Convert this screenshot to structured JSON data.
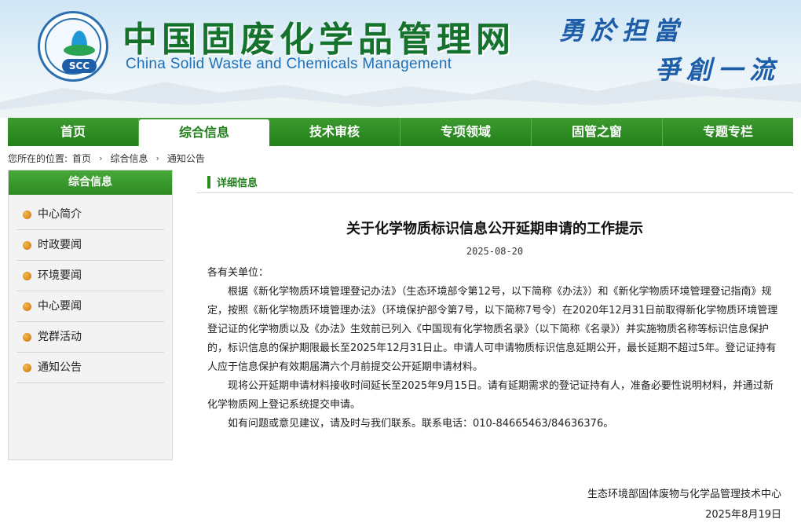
{
  "header": {
    "logo_text": "SCC",
    "title_cn": "中国固废化学品管理网",
    "title_en": "China Solid Waste and Chemicals Management",
    "slogan_line1": "勇於担當",
    "slogan_line2": "爭創一流"
  },
  "nav": {
    "items": [
      "首页",
      "综合信息",
      "技术审核",
      "专项领域",
      "固管之窗",
      "专题专栏"
    ],
    "active_index": 1
  },
  "breadcrumb": {
    "prefix": "您所在的位置:",
    "items": [
      "首页",
      "综合信息",
      "通知公告"
    ],
    "separator": "›"
  },
  "sidebar": {
    "title": "综合信息",
    "items": [
      "中心简介",
      "时政要闻",
      "环境要闻",
      "中心要闻",
      "党群活动",
      "通知公告"
    ]
  },
  "content": {
    "section_label": "详细信息",
    "title": "关于化学物质标识信息公开延期申请的工作提示",
    "date": "2025-08-20",
    "greeting": "各有关单位：",
    "paragraphs": [
      "根据《新化学物质环境管理登记办法》（生态环境部令第12号，以下简称《办法》）和《新化学物质环境管理登记指南》规定，按照《新化学物质环境管理办法》（环境保护部令第7号，以下简称7号令）在2020年12月31日前取得新化学物质环境管理登记证的化学物质以及《办法》生效前已列入《中国现有化学物质名录》（以下简称《名录》）并实施物质名称等标识信息保护的，标识信息的保护期限最长至2025年12月31日止。申请人可申请物质标识信息延期公开，最长延期不超过5年。登记证持有人应于信息保护有效期届满六个月前提交公开延期申请材料。",
      "现将公开延期申请材料接收时间延长至2025年9月15日。请有延期需求的登记证持有人，准备必要性说明材料，并通过新化学物质网上登记系统提交申请。",
      "如有问题或意见建议，请及时与我们联系。联系电话：010-84665463/84636376。"
    ],
    "signature_org": "生态环境部固体废物与化学品管理技术中心",
    "signature_date": "2025年8月19日"
  },
  "colors": {
    "nav_green": "#23801b",
    "title_green": "#15722c",
    "accent_blue": "#1e6fb6",
    "bullet_orange": "#d9861a"
  }
}
